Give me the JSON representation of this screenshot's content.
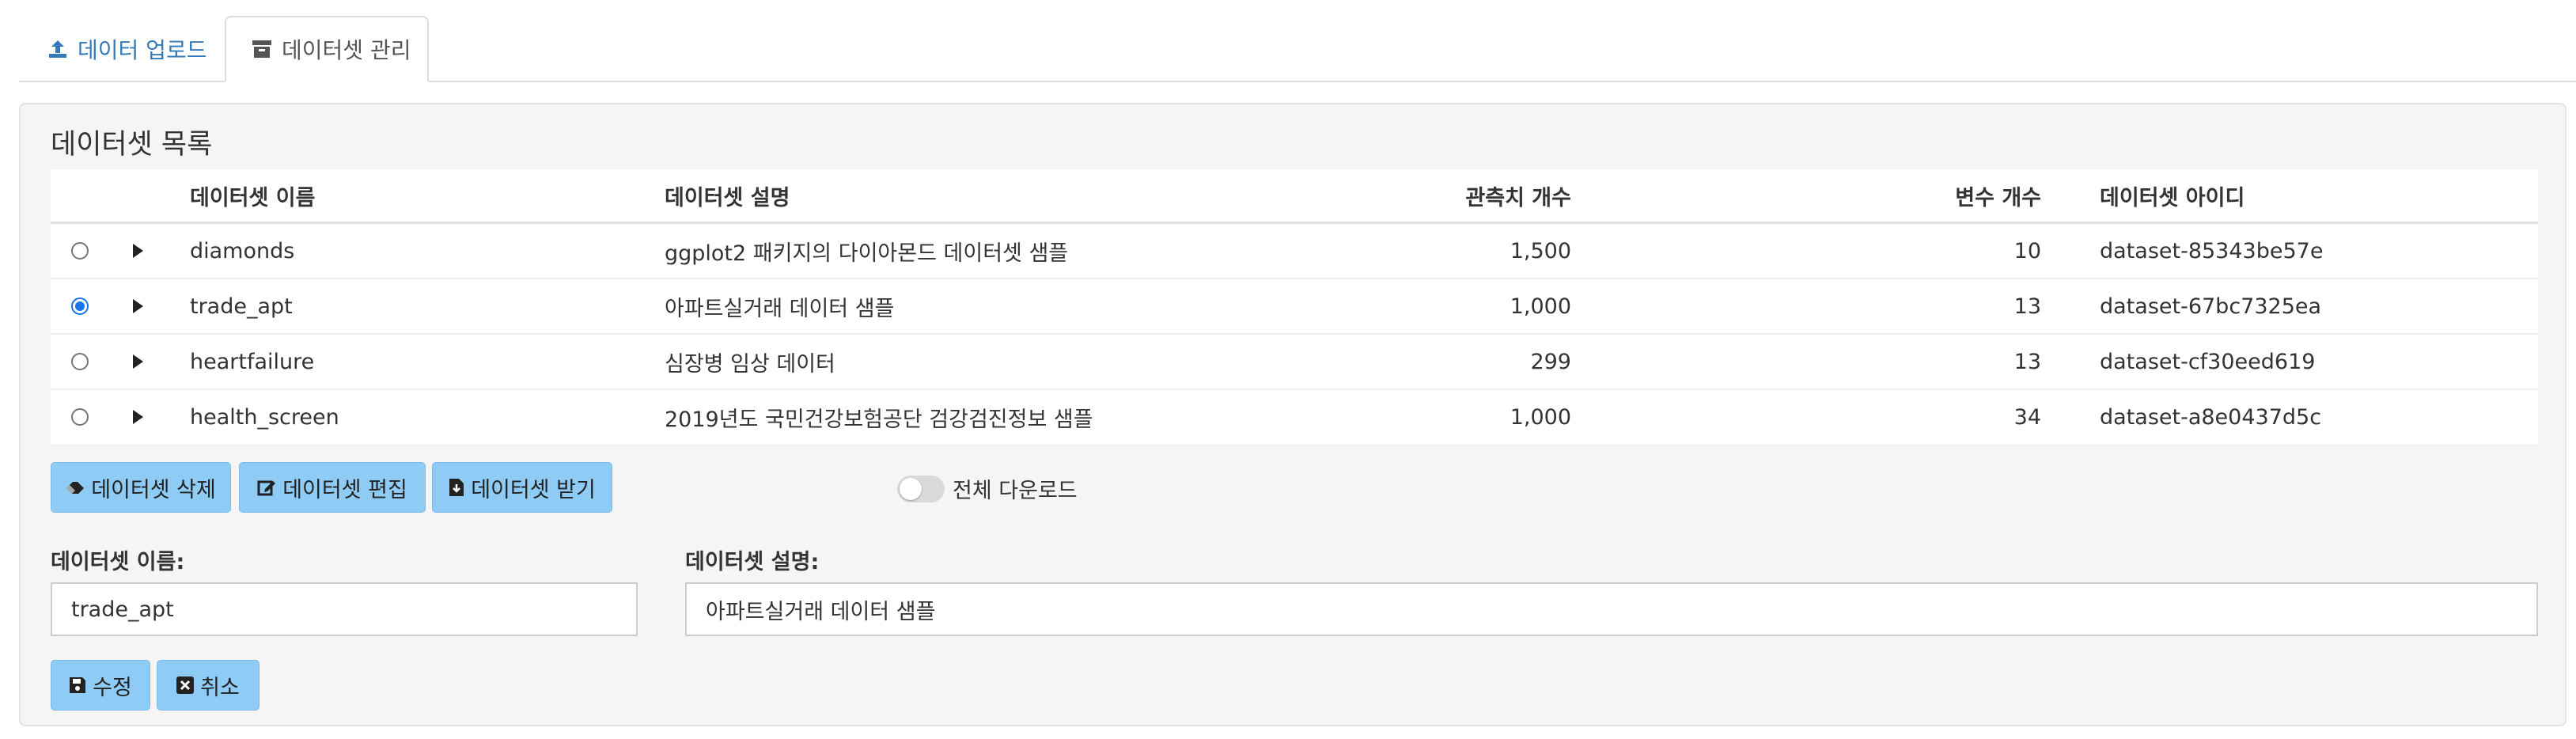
{
  "tabs": [
    {
      "label": "데이터 업로드",
      "icon": "upload-icon",
      "active": false
    },
    {
      "label": "데이터셋 관리",
      "icon": "archive-icon",
      "active": true
    }
  ],
  "panel": {
    "title": "데이터셋 목록",
    "table": {
      "headers": [
        "데이터셋 이름",
        "데이터셋 설명",
        "관측치 개수",
        "변수 개수",
        "데이터셋 아이디"
      ],
      "rows": [
        {
          "selected": false,
          "name": "diamonds",
          "description": "ggplot2 패키지의 다이아몬드 데이터셋 샘플",
          "observations": "1,500",
          "variables": "10",
          "id": "dataset-85343be57e"
        },
        {
          "selected": true,
          "name": "trade_apt",
          "description": "아파트실거래 데이터 샘플",
          "observations": "1,000",
          "variables": "13",
          "id": "dataset-67bc7325ea"
        },
        {
          "selected": false,
          "name": "heartfailure",
          "description": "심장병 임상 데이터",
          "observations": "299",
          "variables": "13",
          "id": "dataset-cf30eed619"
        },
        {
          "selected": false,
          "name": "health_screen",
          "description": "2019년도 국민건강보험공단 검강검진정보 샘플",
          "observations": "1,000",
          "variables": "34",
          "id": "dataset-a8e0437d5c"
        }
      ]
    },
    "buttons": {
      "delete": "데이터셋 삭제",
      "edit": "데이터셋 편집",
      "download": "데이터셋 받기"
    },
    "toggle": {
      "label": "전체 다운로드",
      "on": false
    },
    "form": {
      "name_label": "데이터셋 이름:",
      "name_value": "trade_apt",
      "desc_label": "데이터셋 설명:",
      "desc_value": "아파트실거래 데이터 샘플",
      "save": "수정",
      "cancel": "취소"
    }
  },
  "colors": {
    "accent": "#337ab7",
    "button_bg": "#8ecbf5",
    "radio_selected": "#1a73e8",
    "panel_bg": "#f5f5f5"
  }
}
